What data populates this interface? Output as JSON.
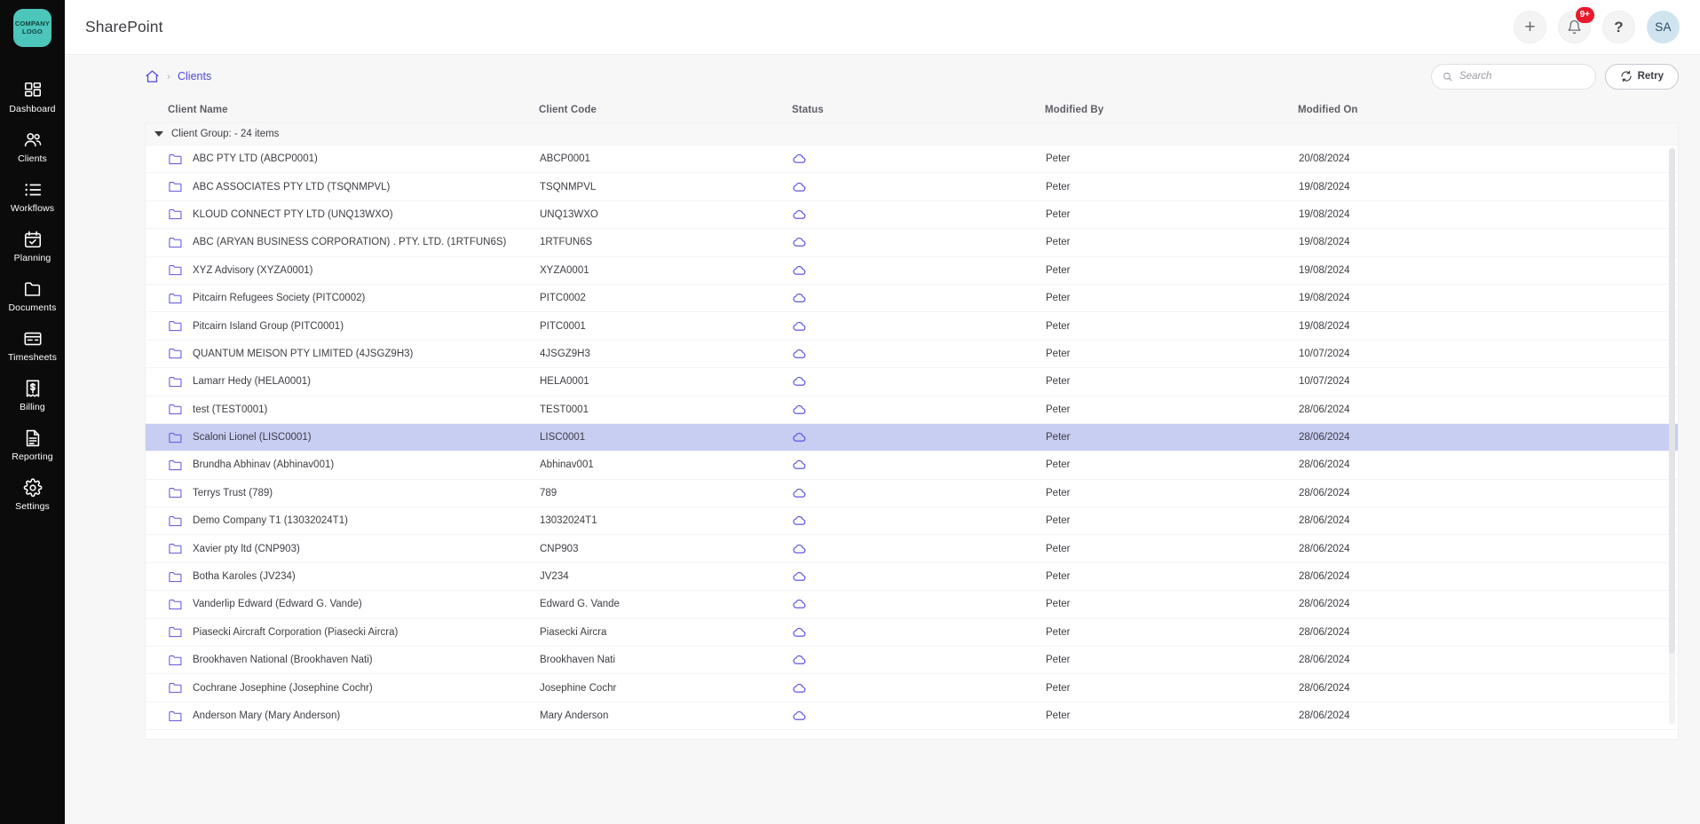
{
  "brand": {
    "logo_line1": "COMPANY",
    "logo_line2": "LOGO",
    "logo_color": "#4cc6bb"
  },
  "sidebar": {
    "items": [
      {
        "label": "Dashboard",
        "icon": "dashboard-icon"
      },
      {
        "label": "Clients",
        "icon": "clients-icon"
      },
      {
        "label": "Workflows",
        "icon": "workflows-icon"
      },
      {
        "label": "Planning",
        "icon": "planning-icon"
      },
      {
        "label": "Documents",
        "icon": "documents-icon"
      },
      {
        "label": "Timesheets",
        "icon": "timesheets-icon"
      },
      {
        "label": "Billing",
        "icon": "billing-icon"
      },
      {
        "label": "Reporting",
        "icon": "reporting-icon"
      },
      {
        "label": "Settings",
        "icon": "settings-icon"
      }
    ]
  },
  "header": {
    "title": "SharePoint",
    "add_icon": "plus-icon",
    "notification_icon": "bell-icon",
    "notification_badge": "9+",
    "help_icon": "question-mark-icon",
    "avatar_initials": "SA",
    "badge_color": "#e8192c",
    "avatar_color": "#cfe4ef"
  },
  "breadcrumb": {
    "home_icon": "home-icon",
    "separator": "›",
    "current": "Clients",
    "accent_color": "#4f46d6"
  },
  "search": {
    "placeholder": "Search",
    "value": "",
    "icon": "search-icon"
  },
  "retry": {
    "label": "Retry",
    "icon": "refresh-icon"
  },
  "table": {
    "columns": [
      "Client Name",
      "Client Code",
      "Status",
      "Modified By",
      "Modified On"
    ],
    "group": {
      "label": "Client Group: - 24 items",
      "expanded": true,
      "toggle_icon": "triangle-down-icon"
    },
    "status_icon": "cloud-icon",
    "row_icon": "folder-icon",
    "selected_index": 10,
    "rows": [
      {
        "name": "ABC PTY LTD (ABCP0001)",
        "code": "ABCP0001",
        "modified_by": "Peter",
        "modified_on": "20/08/2024"
      },
      {
        "name": "ABC ASSOCIATES PTY LTD (TSQNMPVL)",
        "code": "TSQNMPVL",
        "modified_by": "Peter",
        "modified_on": "19/08/2024"
      },
      {
        "name": "KLOUD CONNECT PTY LTD (UNQ13WXO)",
        "code": "UNQ13WXO",
        "modified_by": "Peter",
        "modified_on": "19/08/2024"
      },
      {
        "name": "ABC (ARYAN BUSINESS CORPORATION) . PTY. LTD. (1RTFUN6S)",
        "code": "1RTFUN6S",
        "modified_by": "Peter",
        "modified_on": "19/08/2024"
      },
      {
        "name": "XYZ Advisory (XYZA0001)",
        "code": "XYZA0001",
        "modified_by": "Peter",
        "modified_on": "19/08/2024"
      },
      {
        "name": "Pitcairn Refugees Society (PITC0002)",
        "code": "PITC0002",
        "modified_by": "Peter",
        "modified_on": "19/08/2024"
      },
      {
        "name": "Pitcairn Island Group (PITC0001)",
        "code": "PITC0001",
        "modified_by": "Peter",
        "modified_on": "19/08/2024"
      },
      {
        "name": "QUANTUM MEISON PTY LIMITED (4JSGZ9H3)",
        "code": "4JSGZ9H3",
        "modified_by": "Peter",
        "modified_on": "10/07/2024"
      },
      {
        "name": "Lamarr Hedy (HELA0001)",
        "code": "HELA0001",
        "modified_by": "Peter",
        "modified_on": "10/07/2024"
      },
      {
        "name": "test (TEST0001)",
        "code": "TEST0001",
        "modified_by": "Peter",
        "modified_on": "28/06/2024"
      },
      {
        "name": "Scaloni Lionel (LISC0001)",
        "code": "LISC0001",
        "modified_by": "Peter",
        "modified_on": "28/06/2024"
      },
      {
        "name": "Brundha Abhinav (Abhinav001)",
        "code": "Abhinav001",
        "modified_by": "Peter",
        "modified_on": "28/06/2024"
      },
      {
        "name": "Terrys Trust (789)",
        "code": "789",
        "modified_by": "Peter",
        "modified_on": "28/06/2024"
      },
      {
        "name": "Demo Company T1 (13032024T1)",
        "code": "13032024T1",
        "modified_by": "Peter",
        "modified_on": "28/06/2024"
      },
      {
        "name": "Xavier pty ltd (CNP903)",
        "code": "CNP903",
        "modified_by": "Peter",
        "modified_on": "28/06/2024"
      },
      {
        "name": "Botha Karoles (JV234)",
        "code": "JV234",
        "modified_by": "Peter",
        "modified_on": "28/06/2024"
      },
      {
        "name": "Vanderlip Edward (Edward G. Vande)",
        "code": "Edward G. Vande",
        "modified_by": "Peter",
        "modified_on": "28/06/2024"
      },
      {
        "name": "Piasecki Aircraft Corporation (Piasecki Aircra)",
        "code": "Piasecki Aircra",
        "modified_by": "Peter",
        "modified_on": "28/06/2024"
      },
      {
        "name": "Brookhaven National (Brookhaven Nati)",
        "code": "Brookhaven Nati",
        "modified_by": "Peter",
        "modified_on": "28/06/2024"
      },
      {
        "name": "Cochrane Josephine (Josephine Cochr)",
        "code": "Josephine Cochr",
        "modified_by": "Peter",
        "modified_on": "28/06/2024"
      },
      {
        "name": "Anderson Mary (Mary Anderson)",
        "code": "Mary Anderson",
        "modified_by": "Peter",
        "modified_on": "28/06/2024"
      }
    ]
  }
}
